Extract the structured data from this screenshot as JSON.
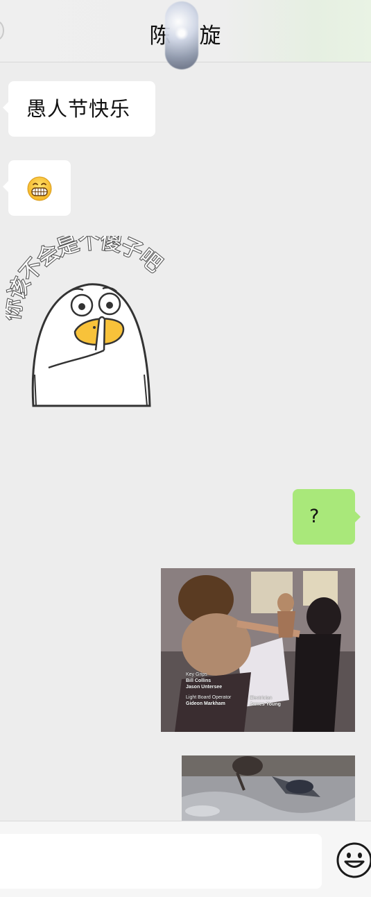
{
  "header": {
    "title_left": "陈",
    "title_right": "旋"
  },
  "messages": [
    {
      "side": "left",
      "type": "text",
      "text": "愚人节快乐"
    },
    {
      "side": "left",
      "type": "emoji",
      "icon": "grinning-face-icon"
    },
    {
      "side": "left",
      "type": "sticker",
      "caption": "你该不会是个傻子吧"
    },
    {
      "side": "right",
      "type": "text",
      "text": "?"
    },
    {
      "side": "right",
      "type": "image",
      "credits": {
        "left_heading": "Key Grips",
        "left_line1": "Bill Collins",
        "left_line2": "Jason Untersee",
        "left_heading2": "Light Board Operator",
        "left_line3": "Gideon Markham",
        "right_heading": "Electrician",
        "right_line1": "James Young"
      }
    },
    {
      "side": "right",
      "type": "image"
    }
  ],
  "input_bar": {
    "text_value": "",
    "emoji_button_icon": "smiley-face-icon"
  },
  "colors": {
    "background": "#ededed",
    "incoming_bubble": "#ffffff",
    "outgoing_bubble": "#a9e87a"
  }
}
